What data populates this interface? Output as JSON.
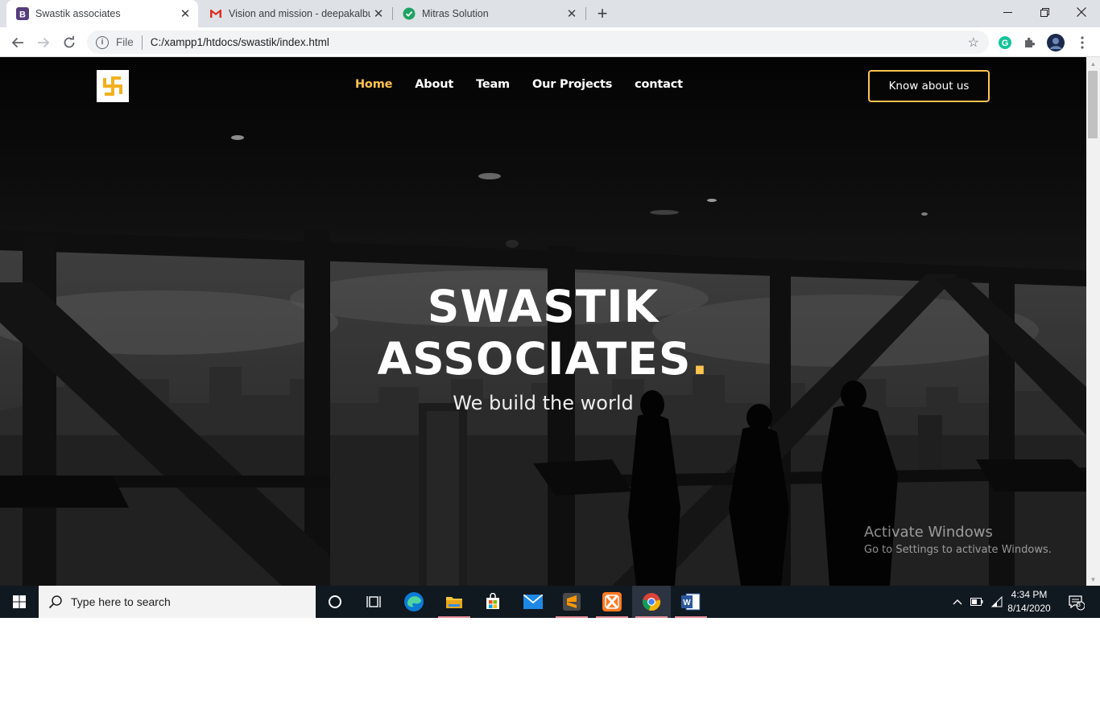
{
  "browser": {
    "tabs": [
      {
        "title": "Swastik associates",
        "favicon": "bootstrap-b-icon",
        "active": true
      },
      {
        "title": "Vision and mission - deepakalbur",
        "favicon": "gmail-icon",
        "active": false
      },
      {
        "title": "Mitras Solution",
        "favicon": "green-check-icon",
        "active": false
      }
    ],
    "address": {
      "scheme_label": "File",
      "url": "C:/xampp1/htdocs/swastik/index.html"
    }
  },
  "site": {
    "nav": [
      {
        "label": "Home",
        "active": true
      },
      {
        "label": "About",
        "active": false
      },
      {
        "label": "Team",
        "active": false
      },
      {
        "label": "Our Projects",
        "active": false
      },
      {
        "label": "contact",
        "active": false
      }
    ],
    "cta_label": "Know about us",
    "hero": {
      "title_line1": "SWASTIK",
      "title_line2": "ASSOCIATES",
      "title_dot": ".",
      "subtitle": "We build the world"
    },
    "accent_color": "#ffc451"
  },
  "watermark": {
    "line1": "Activate Windows",
    "line2": "Go to Settings to activate Windows."
  },
  "taskbar": {
    "search_placeholder": "Type here to search",
    "time": "4:34 PM",
    "date": "8/14/2020",
    "notification_count": "3",
    "apps": [
      "cortana-icon",
      "task-view-icon",
      "edge-icon",
      "file-explorer-icon",
      "store-icon",
      "mail-icon",
      "sublime-text-icon",
      "xampp-icon",
      "chrome-icon",
      "word-icon"
    ]
  }
}
